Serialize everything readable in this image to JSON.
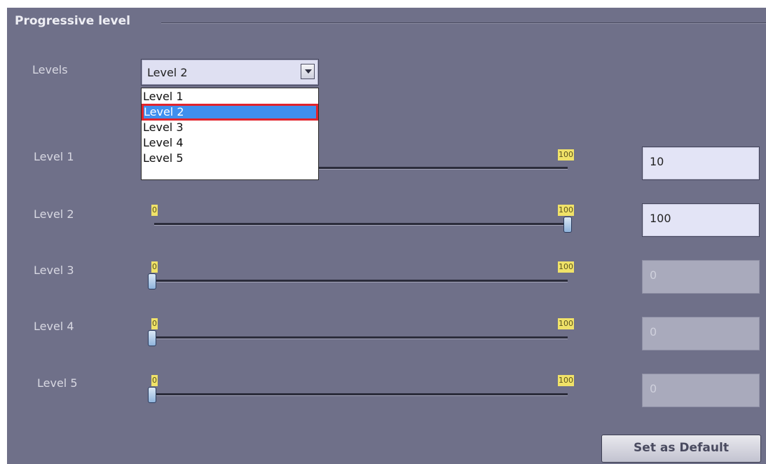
{
  "group": {
    "title": "Progressive level"
  },
  "levels_field": {
    "label": "Levels",
    "selected": "Level 2",
    "options": [
      "Level 1",
      "Level 2",
      "Level 3",
      "Level 4",
      "Level 5"
    ],
    "highlighted_index": 1
  },
  "sliders": [
    {
      "label": "Level 1",
      "min": "0",
      "max": "100",
      "value": 10,
      "field_value": "10",
      "enabled": true
    },
    {
      "label": "Level 2",
      "min": "0",
      "max": "100",
      "value": 100,
      "field_value": "100",
      "enabled": true
    },
    {
      "label": "Level 3",
      "min": "0",
      "max": "100",
      "value": 0,
      "field_value": "0",
      "enabled": false
    },
    {
      "label": "Level 4",
      "min": "0",
      "max": "100",
      "value": 0,
      "field_value": "0",
      "enabled": false
    },
    {
      "label": "Level 5",
      "min": "0",
      "max": "100",
      "value": 0,
      "field_value": "0",
      "enabled": false
    }
  ],
  "buttons": {
    "set_default": "Set as Default"
  },
  "colors": {
    "panel_bg": "#6f7089",
    "selection_highlight": "#3f8fef",
    "selection_outline": "#e2242c",
    "scale_marker": "#f0e268"
  }
}
